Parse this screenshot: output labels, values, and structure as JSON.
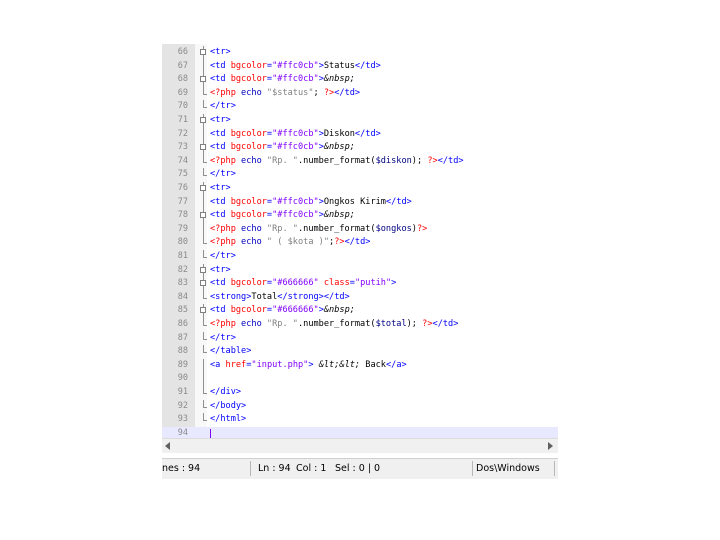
{
  "editor": {
    "lines": [
      {
        "num": "66",
        "fold": "box",
        "segs": [
          [
            "tag",
            "<tr>"
          ]
        ]
      },
      {
        "num": "67",
        "fold": "line",
        "segs": [
          [
            "tag",
            "<td "
          ],
          [
            "attr",
            "bgcolor"
          ],
          [
            "tag",
            "="
          ],
          [
            "str",
            "\"#ffc0cb\""
          ],
          [
            "tag",
            ">"
          ],
          [
            "txt",
            "Status"
          ],
          [
            "tag",
            "</td>"
          ]
        ]
      },
      {
        "num": "68",
        "fold": "box",
        "segs": [
          [
            "tag",
            "<td "
          ],
          [
            "attr",
            "bgcolor"
          ],
          [
            "tag",
            "="
          ],
          [
            "str",
            "\"#ffc0cb\""
          ],
          [
            "tag",
            ">"
          ],
          [
            "ent",
            "&nbsp;"
          ]
        ]
      },
      {
        "num": "69",
        "fold": "end",
        "segs": [
          [
            "php",
            "<?php "
          ],
          [
            "kw",
            "echo "
          ],
          [
            "pstr",
            "\"$status\""
          ],
          [
            "txt",
            "; "
          ],
          [
            "php",
            "?>"
          ],
          [
            "tag",
            "</td>"
          ]
        ]
      },
      {
        "num": "70",
        "fold": "end",
        "segs": [
          [
            "tag",
            "</tr>"
          ]
        ]
      },
      {
        "num": "71",
        "fold": "box",
        "segs": [
          [
            "tag",
            "<tr>"
          ]
        ]
      },
      {
        "num": "72",
        "fold": "line",
        "segs": [
          [
            "tag",
            "<td "
          ],
          [
            "attr",
            "bgcolor"
          ],
          [
            "tag",
            "="
          ],
          [
            "str",
            "\"#ffc0cb\""
          ],
          [
            "tag",
            ">"
          ],
          [
            "txt",
            "Diskon"
          ],
          [
            "tag",
            "</td>"
          ]
        ]
      },
      {
        "num": "73",
        "fold": "box",
        "segs": [
          [
            "tag",
            "<td "
          ],
          [
            "attr",
            "bgcolor"
          ],
          [
            "tag",
            "="
          ],
          [
            "str",
            "\"#ffc0cb\""
          ],
          [
            "tag",
            ">"
          ],
          [
            "ent",
            "&nbsp;"
          ]
        ]
      },
      {
        "num": "74",
        "fold": "end",
        "segs": [
          [
            "php",
            "<?php "
          ],
          [
            "kw",
            "echo "
          ],
          [
            "pstr",
            "\"Rp. \""
          ],
          [
            "txt",
            ".number_format("
          ],
          [
            "pvar",
            "$diskon"
          ],
          [
            "txt",
            "); "
          ],
          [
            "php",
            "?>"
          ],
          [
            "tag",
            "</td>"
          ]
        ]
      },
      {
        "num": "75",
        "fold": "end",
        "segs": [
          [
            "tag",
            "</tr>"
          ]
        ]
      },
      {
        "num": "76",
        "fold": "box",
        "segs": [
          [
            "tag",
            "<tr>"
          ]
        ]
      },
      {
        "num": "77",
        "fold": "line",
        "segs": [
          [
            "tag",
            "<td "
          ],
          [
            "attr",
            "bgcolor"
          ],
          [
            "tag",
            "="
          ],
          [
            "str",
            "\"#ffc0cb\""
          ],
          [
            "tag",
            ">"
          ],
          [
            "txt",
            "Ongkos Kirim"
          ],
          [
            "tag",
            "</td>"
          ]
        ]
      },
      {
        "num": "78",
        "fold": "box",
        "segs": [
          [
            "tag",
            "<td "
          ],
          [
            "attr",
            "bgcolor"
          ],
          [
            "tag",
            "="
          ],
          [
            "str",
            "\"#ffc0cb\""
          ],
          [
            "tag",
            ">"
          ],
          [
            "ent",
            "&nbsp;"
          ]
        ]
      },
      {
        "num": "79",
        "fold": "line",
        "segs": [
          [
            "php",
            "<?php "
          ],
          [
            "kw",
            "echo "
          ],
          [
            "pstr",
            "\"Rp. \""
          ],
          [
            "txt",
            ".number_format("
          ],
          [
            "pvar",
            "$ongkos"
          ],
          [
            "txt",
            ")"
          ],
          [
            "php",
            "?>"
          ]
        ]
      },
      {
        "num": "80",
        "fold": "end",
        "segs": [
          [
            "php",
            "<?php "
          ],
          [
            "kw",
            "echo "
          ],
          [
            "pstr",
            "\" ( $kota )\""
          ],
          [
            "txt",
            ";"
          ],
          [
            "php",
            "?>"
          ],
          [
            "tag",
            "</td>"
          ]
        ]
      },
      {
        "num": "81",
        "fold": "end",
        "segs": [
          [
            "tag",
            "</tr>"
          ]
        ]
      },
      {
        "num": "82",
        "fold": "box",
        "segs": [
          [
            "tag",
            "<tr>"
          ]
        ]
      },
      {
        "num": "83",
        "fold": "box",
        "segs": [
          [
            "tag",
            "<td "
          ],
          [
            "attr",
            "bgcolor"
          ],
          [
            "tag",
            "="
          ],
          [
            "str",
            "\"#666666\""
          ],
          [
            "tag",
            " "
          ],
          [
            "attr",
            "class"
          ],
          [
            "tag",
            "="
          ],
          [
            "str",
            "\"putih\""
          ],
          [
            "tag",
            ">"
          ]
        ]
      },
      {
        "num": "84",
        "fold": "end",
        "segs": [
          [
            "tag",
            "<strong>"
          ],
          [
            "txt",
            "Total"
          ],
          [
            "tag",
            "</strong></td>"
          ]
        ]
      },
      {
        "num": "85",
        "fold": "box",
        "segs": [
          [
            "tag",
            "<td "
          ],
          [
            "attr",
            "bgcolor"
          ],
          [
            "tag",
            "="
          ],
          [
            "str",
            "\"#666666\""
          ],
          [
            "tag",
            ">"
          ],
          [
            "ent",
            "&nbsp;"
          ]
        ]
      },
      {
        "num": "86",
        "fold": "end",
        "segs": [
          [
            "php",
            "<?php "
          ],
          [
            "kw",
            "echo "
          ],
          [
            "pstr",
            "\"Rp. \""
          ],
          [
            "txt",
            ".number_format("
          ],
          [
            "pvar",
            "$total"
          ],
          [
            "txt",
            "); "
          ],
          [
            "php",
            "?>"
          ],
          [
            "tag",
            "</td>"
          ]
        ]
      },
      {
        "num": "87",
        "fold": "end",
        "segs": [
          [
            "tag",
            "</tr>"
          ]
        ]
      },
      {
        "num": "88",
        "fold": "end",
        "segs": [
          [
            "tag",
            "</table>"
          ]
        ]
      },
      {
        "num": "89",
        "fold": "line",
        "segs": [
          [
            "tag",
            "<a "
          ],
          [
            "attr",
            "href"
          ],
          [
            "tag",
            "="
          ],
          [
            "str",
            "\"input.php\""
          ],
          [
            "tag",
            "> "
          ],
          [
            "ent",
            "&lt;&lt;"
          ],
          [
            "txt",
            " Back"
          ],
          [
            "tag",
            "</a>"
          ]
        ]
      },
      {
        "num": "90",
        "fold": "line",
        "segs": []
      },
      {
        "num": "91",
        "fold": "end",
        "segs": [
          [
            "tag",
            "</div>"
          ]
        ]
      },
      {
        "num": "92",
        "fold": "end",
        "segs": [
          [
            "tag",
            "</body>"
          ]
        ]
      },
      {
        "num": "93",
        "fold": "end",
        "segs": [
          [
            "tag",
            "</html>"
          ]
        ]
      },
      {
        "num": "94",
        "fold": "none",
        "current": true,
        "segs": []
      }
    ]
  },
  "status": {
    "lines": "nes : 94",
    "ln": "Ln : 94",
    "col": "Col : 1",
    "sel": "Sel : 0 | 0",
    "eol": "Dos\\Windows"
  }
}
